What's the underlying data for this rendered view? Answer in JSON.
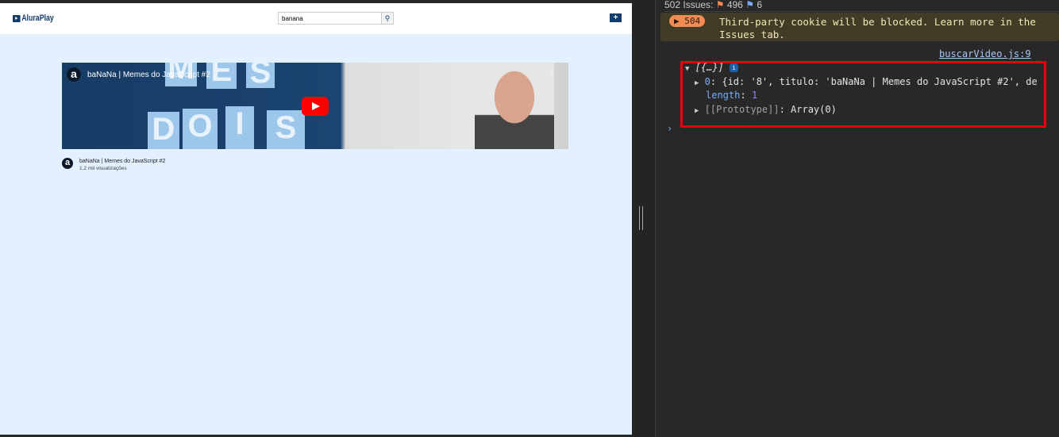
{
  "app": {
    "logo": "AluraPlay",
    "search_value": "banana",
    "search_icon": "search-icon",
    "add_video_icon": "video-plus-icon"
  },
  "video": {
    "title": "baNaNa | Memes do JavaScript #2",
    "views": "1,2 mil visualizações",
    "channel_avatar": "a",
    "thumb_letters": [
      "D",
      "O",
      "I",
      "S"
    ]
  },
  "devtools": {
    "issues": "502 Issues:",
    "issues_warn": "496",
    "issues_info": "6",
    "warning": {
      "count": "504",
      "text": "Third-party cookie will be blocked. Learn more in the Issues tab."
    },
    "source_link": "buscarVideo.js:9",
    "log": {
      "summary": "[{…}]",
      "item0_key": "0",
      "item0_text": "{id: '8', titulo: 'baNaNa | Memes do JavaScript #2', de",
      "length_key": "length",
      "length_val": "1",
      "proto_key": "[[Prototype]]",
      "proto_val": "Array(0)"
    },
    "highlight_color": "#e3000f"
  }
}
